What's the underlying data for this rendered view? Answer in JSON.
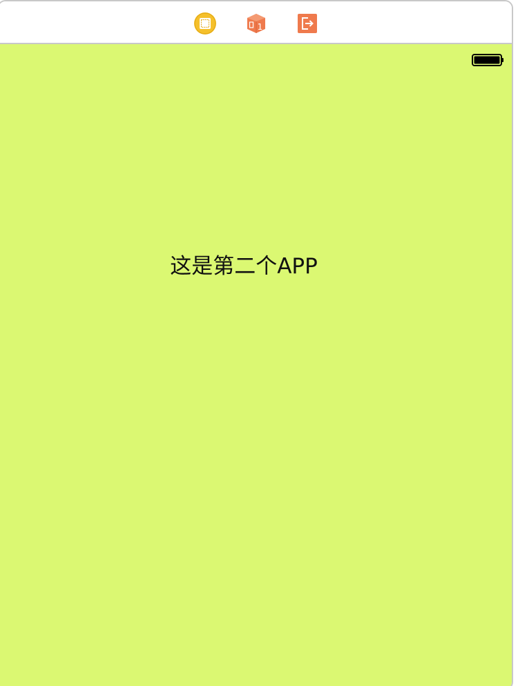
{
  "scene_dock": {
    "icons": [
      {
        "name": "view-controller-icon",
        "color": "#F5C02B"
      },
      {
        "name": "first-responder-icon",
        "color": "#EF7A4D"
      },
      {
        "name": "exit-icon",
        "color": "#EF7A4D"
      }
    ],
    "first_responder_badge": "1"
  },
  "view": {
    "background_color": "#DBF872",
    "label_text": "这是第二个APP"
  },
  "status_bar": {
    "battery_icon": "battery-full-icon"
  }
}
